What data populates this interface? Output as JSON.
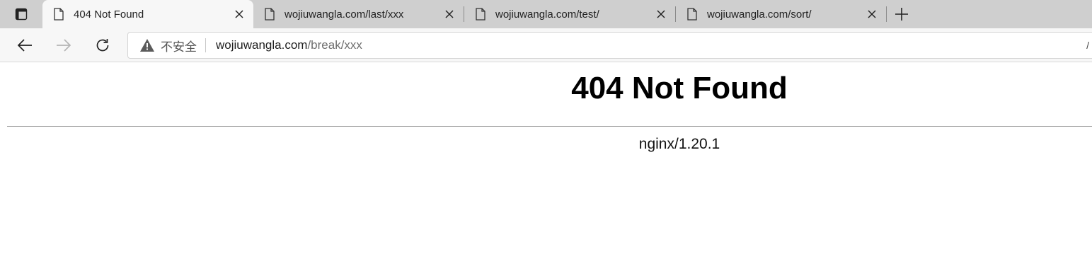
{
  "tabs": [
    {
      "title": "404 Not Found",
      "active": true
    },
    {
      "title": "wojiuwangla.com/last/xxx",
      "active": false
    },
    {
      "title": "wojiuwangla.com/test/",
      "active": false
    },
    {
      "title": "wojiuwangla.com/sort/",
      "active": false
    }
  ],
  "address": {
    "security_label": "不安全",
    "host": "wojiuwangla.com",
    "path": "/break/xxx",
    "right_glyph": "/"
  },
  "page": {
    "heading": "404 Not Found",
    "server": "nginx/1.20.1"
  },
  "colors": {
    "tabstrip": "#cfcfcf",
    "active_tab": "#f7f7f7",
    "toolbar": "#f7f7f7"
  }
}
